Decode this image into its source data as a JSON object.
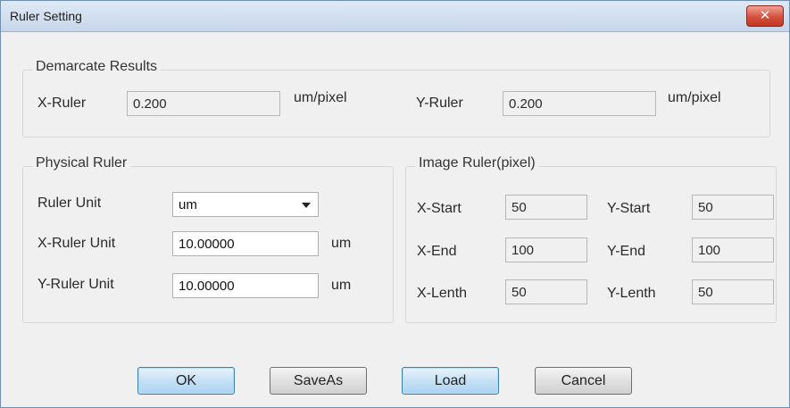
{
  "window": {
    "title": "Ruler Setting",
    "close_glyph": "✕"
  },
  "demarcate": {
    "legend": "Demarcate Results",
    "x_label": "X-Ruler",
    "x_value": "0.200",
    "x_unit": "um/pixel",
    "y_label": "Y-Ruler",
    "y_value": "0.200",
    "y_unit": "um/pixel"
  },
  "physical": {
    "legend": "Physical Ruler",
    "unit_label": "Ruler Unit",
    "unit_value": "um",
    "x_label": "X-Ruler Unit",
    "x_value": "10.00000",
    "x_unit": "um",
    "y_label": "Y-Ruler Unit",
    "y_value": "10.00000",
    "y_unit": "um"
  },
  "image": {
    "legend": "Image Ruler(pixel)",
    "x_start_label": "X-Start",
    "x_start": "50",
    "y_start_label": "Y-Start",
    "y_start": "50",
    "x_end_label": "X-End",
    "x_end": "100",
    "y_end_label": "Y-End",
    "y_end": "100",
    "x_len_label": "X-Lenth",
    "x_len": "50",
    "y_len_label": "Y-Lenth",
    "y_len": "50"
  },
  "buttons": {
    "ok": "OK",
    "saveas": "SaveAs",
    "load": "Load",
    "cancel": "Cancel"
  }
}
